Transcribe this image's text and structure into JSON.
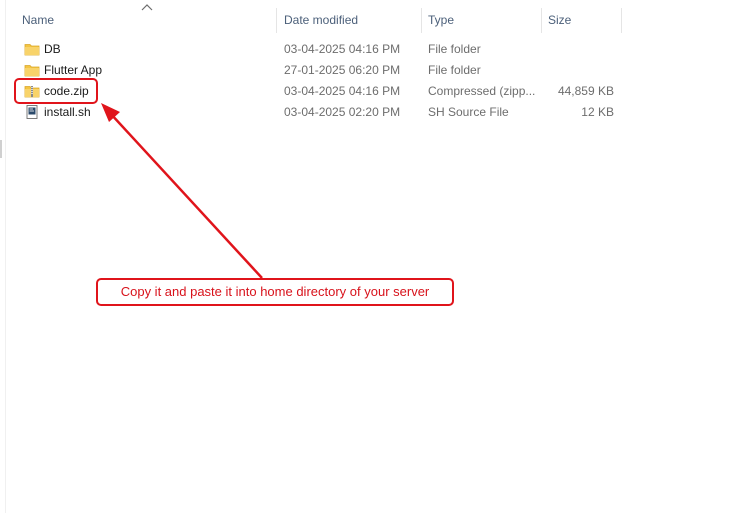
{
  "columns": {
    "name": "Name",
    "date_modified": "Date modified",
    "type": "Type",
    "size": "Size"
  },
  "files": [
    {
      "name": "DB",
      "date": "03-04-2025 04:16 PM",
      "type": "File folder",
      "size": "",
      "icon": "folder-icon"
    },
    {
      "name": "Flutter App",
      "date": "27-01-2025 06:20 PM",
      "type": "File folder",
      "size": "",
      "icon": "folder-icon"
    },
    {
      "name": "code.zip",
      "date": "03-04-2025 04:16 PM",
      "type": "Compressed (zipp...",
      "size": "44,859 KB",
      "icon": "zip-folder-icon"
    },
    {
      "name": "install.sh",
      "date": "03-04-2025 02:20 PM",
      "type": "SH Source File",
      "size": "12 KB",
      "icon": "script-file-icon"
    }
  ],
  "annotation": {
    "callout_text": "Copy it and paste it into home directory of your server",
    "color": "#e0141b"
  },
  "colors": {
    "header_text": "#4c607a",
    "folder_yellow": "#f4c542"
  },
  "sort_indicator": "sort-ascending-icon"
}
